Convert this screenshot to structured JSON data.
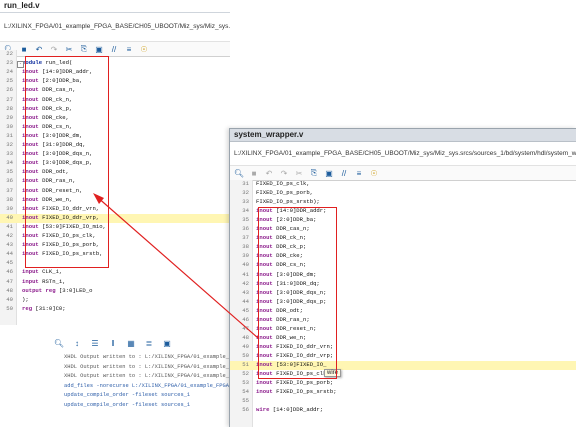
{
  "left_window": {
    "title": "run_led.v",
    "path": "L:/XILINX_FPGA/01_example_FPGA_BASE/CH05_UBOOT/Miz_sys/Miz_sys.srcs/sources_1/new/run_led.v",
    "lines": [
      {
        "n": "22",
        "t": ""
      },
      {
        "n": "23",
        "t": "module run_led("
      },
      {
        "n": "24",
        "t": "inout [14:0]DDR_addr,"
      },
      {
        "n": "25",
        "t": "inout [2:0]DDR_ba,"
      },
      {
        "n": "26",
        "t": "inout DDR_cas_n,"
      },
      {
        "n": "27",
        "t": "inout DDR_ck_n,"
      },
      {
        "n": "28",
        "t": "inout DDR_ck_p,"
      },
      {
        "n": "29",
        "t": "inout DDR_cke,"
      },
      {
        "n": "30",
        "t": "inout DDR_cs_n,"
      },
      {
        "n": "31",
        "t": "inout [3:0]DDR_dm,"
      },
      {
        "n": "32",
        "t": "inout [31:0]DDR_dq,"
      },
      {
        "n": "33",
        "t": "inout [3:0]DDR_dqs_n,"
      },
      {
        "n": "34",
        "t": "inout [3:0]DDR_dqs_p,"
      },
      {
        "n": "35",
        "t": "inout DDR_odt,"
      },
      {
        "n": "36",
        "t": "inout DDR_ras_n,"
      },
      {
        "n": "37",
        "t": "inout DDR_reset_n,"
      },
      {
        "n": "38",
        "t": "inout DDR_we_n,"
      },
      {
        "n": "39",
        "t": "inout FIXED_IO_ddr_vrn,"
      },
      {
        "n": "40",
        "t": "inout FIXED_IO_ddr_vrp,"
      },
      {
        "n": "41",
        "t": "inout [53:0]FIXED_IO_mio,"
      },
      {
        "n": "42",
        "t": "inout FIXED_IO_ps_clk,"
      },
      {
        "n": "43",
        "t": "inout FIXED_IO_ps_porb,"
      },
      {
        "n": "44",
        "t": "inout FIXED_IO_ps_srstb,"
      },
      {
        "n": "45",
        "t": ""
      },
      {
        "n": "46",
        "t": "input CLK_i,"
      },
      {
        "n": "47",
        "t": "input RSTn_i,"
      },
      {
        "n": "48",
        "t": "output reg [3:0]LED_o"
      },
      {
        "n": "49",
        "t": ");"
      },
      {
        "n": "50",
        "t": "reg [31:0]C0;"
      }
    ]
  },
  "console": {
    "lines": [
      {
        "text": "XHDL Output written to : L:/XILINX_FPGA/01_example_FPGA",
        "color": "grey"
      },
      {
        "text": "XHDL Output written to : L:/XILINX_FPGA/01_example_FPGA",
        "color": "grey"
      },
      {
        "text": "XHDL Output written to : L:/XILINX_FPGA/01_example_FPGA",
        "color": "grey"
      },
      {
        "text": "add_files -norecurse L:/XILINX_FPGA/01_example_FPGA_BAS",
        "color": "blue"
      },
      {
        "text": "update_compile_order -fileset sources_1",
        "color": "blue"
      },
      {
        "text": "update_compile_order -fileset sources_1",
        "color": "blue"
      }
    ]
  },
  "right_window": {
    "title": "system_wrapper.v",
    "path": "L:/XILINX_FPGA/01_example_FPGA_BASE/CH05_UBOOT/Miz_sys/Miz_sys.srcs/sources_1/bd/system/hdl/system_wrapper.v",
    "tooltip": "wire",
    "lines": [
      {
        "n": "31",
        "t": "    FIXED_IO_ps_clk,"
      },
      {
        "n": "32",
        "t": "    FIXED_IO_ps_porb,"
      },
      {
        "n": "33",
        "t": "    FIXED_IO_ps_srstb);"
      },
      {
        "n": "34",
        "t": "  inout [14:0]DDR_addr;"
      },
      {
        "n": "35",
        "t": "  inout [2:0]DDR_ba;"
      },
      {
        "n": "36",
        "t": "  inout DDR_cas_n;"
      },
      {
        "n": "37",
        "t": "  inout DDR_ck_n;"
      },
      {
        "n": "38",
        "t": "  inout DDR_ck_p;"
      },
      {
        "n": "39",
        "t": "  inout DDR_cke;"
      },
      {
        "n": "40",
        "t": "  inout DDR_cs_n;"
      },
      {
        "n": "41",
        "t": "  inout [3:0]DDR_dm;"
      },
      {
        "n": "42",
        "t": "  inout [31:0]DDR_dq;"
      },
      {
        "n": "43",
        "t": "  inout [3:0]DDR_dqs_n;"
      },
      {
        "n": "44",
        "t": "  inout [3:0]DDR_dqs_p;"
      },
      {
        "n": "45",
        "t": "  inout DDR_odt;"
      },
      {
        "n": "46",
        "t": "  inout DDR_ras_n;"
      },
      {
        "n": "47",
        "t": "  inout DDR_reset_n;"
      },
      {
        "n": "48",
        "t": "  inout DDR_we_n;"
      },
      {
        "n": "49",
        "t": "  inout FIXED_IO_ddr_vrn;"
      },
      {
        "n": "50",
        "t": "  inout FIXED_IO_ddr_vrp;"
      },
      {
        "n": "51",
        "t": "  inout [53:0]FIXED_IO_"
      },
      {
        "n": "52",
        "t": "  inout FIXED_IO_ps_clk;"
      },
      {
        "n": "53",
        "t": "  inout FIXED_IO_ps_porb;"
      },
      {
        "n": "54",
        "t": "  inout FIXED_IO_ps_srstb;"
      },
      {
        "n": "55",
        "t": ""
      },
      {
        "n": "56",
        "t": "  wire [14:0]DDR_addr;"
      }
    ]
  },
  "colors": {
    "annotation": "#e02020",
    "keyword": "#8b1a8b",
    "titlebar": "#d8dde4"
  },
  "icons": [
    "search-icon",
    "save-icon",
    "undo-icon",
    "redo-icon",
    "cut-icon",
    "copy-icon",
    "paste-icon",
    "comment-icon",
    "columns-icon",
    "bulb-icon"
  ]
}
